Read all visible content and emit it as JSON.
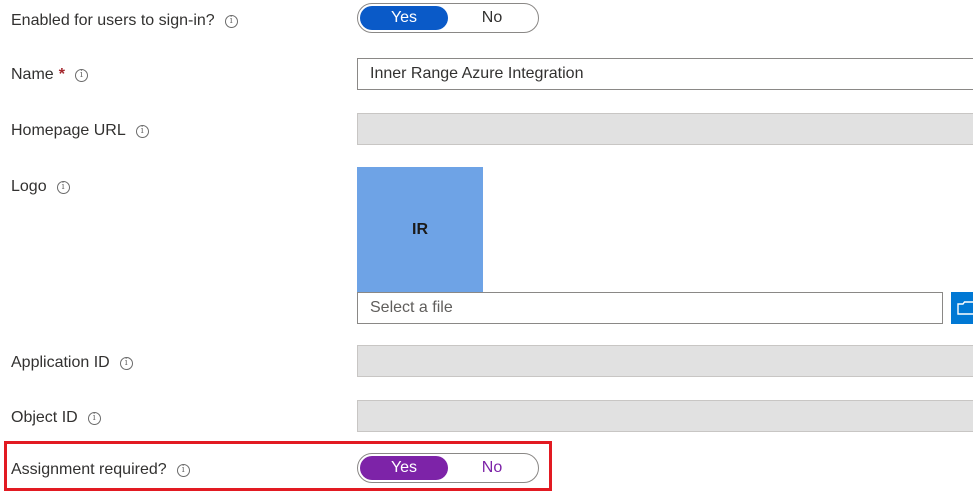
{
  "fields": {
    "enabled": {
      "label": "Enabled for users to sign-in?",
      "yes": "Yes",
      "no": "No",
      "selected": "Yes"
    },
    "name": {
      "label": "Name",
      "required_mark": "*",
      "value": "Inner Range Azure Integration"
    },
    "homepage": {
      "label": "Homepage URL",
      "value": ""
    },
    "logo": {
      "label": "Logo",
      "initials": "IR",
      "file_placeholder": "Select a file"
    },
    "app_id": {
      "label": "Application ID",
      "value": ""
    },
    "object_id": {
      "label": "Object ID",
      "value": ""
    },
    "assignment": {
      "label": "Assignment required?",
      "yes": "Yes",
      "no": "No",
      "selected": "Yes"
    }
  },
  "info_glyph": "i",
  "colors": {
    "toggle_blue": "#0a5ac8",
    "toggle_purple": "#7d23a8",
    "logo_bg": "#6ea3e6",
    "highlight": "#e21a22",
    "check": "#107c10"
  }
}
